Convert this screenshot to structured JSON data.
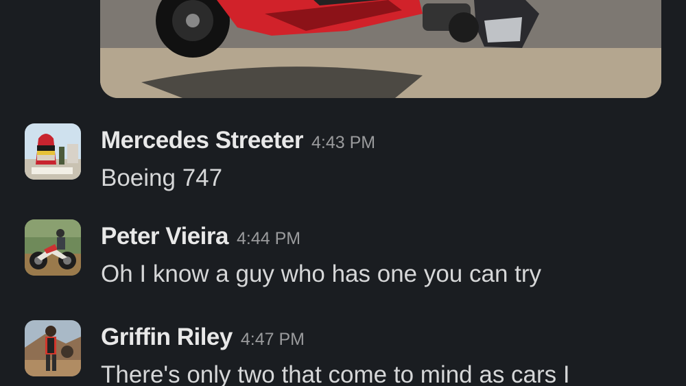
{
  "attachment": {
    "description_icon": "motorcycle-photo"
  },
  "messages": [
    {
      "sender": "Mercedes Streeter",
      "time": "4:43 PM",
      "text": "Boeing 747",
      "avatar_icon": "lighthouse-buoy-photo"
    },
    {
      "sender": "Peter Vieira",
      "time": "4:44 PM",
      "text": "Oh I know a guy who has one you can try",
      "avatar_icon": "dirt-bike-photo"
    },
    {
      "sender": "Griffin Riley",
      "time": "4:47 PM",
      "text": "There's only two that come to mind as cars I",
      "avatar_icon": "person-outdoors-photo"
    }
  ]
}
